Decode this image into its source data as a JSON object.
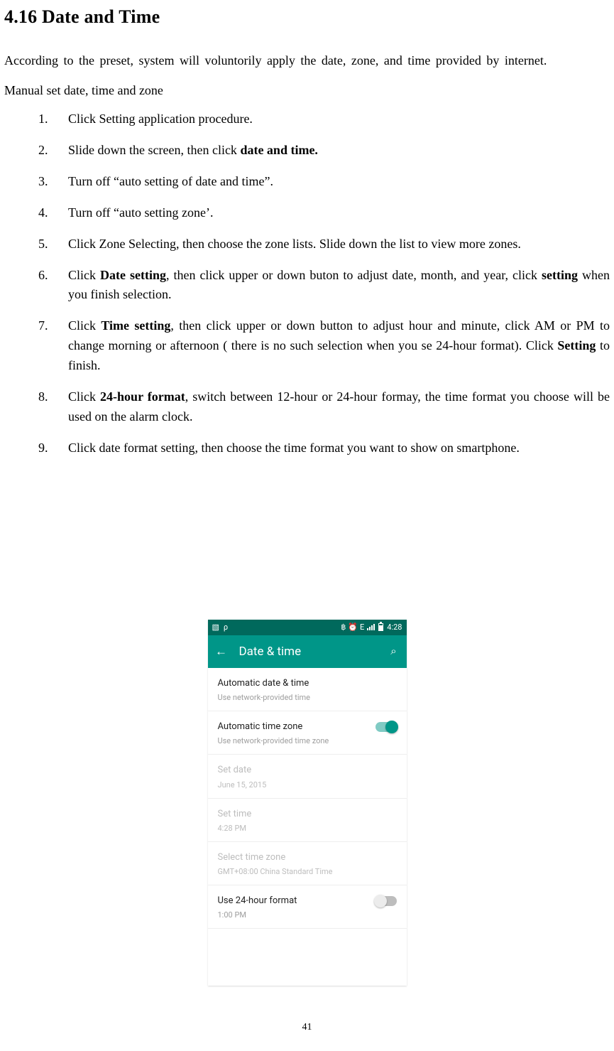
{
  "section_title": "4.16 Date and Time",
  "intro": "According to the preset, system will voluntorily apply the date, zone, and time provided by internet.",
  "subtitle": "Manual set date, time and zone",
  "list": [
    {
      "num": "1.",
      "pre": "Click Setting application procedure."
    },
    {
      "num": "2.",
      "pre": "Slide down the screen, then click ",
      "bold1": "date and time."
    },
    {
      "num": "3.",
      "pre": "Turn off “auto setting of date and time”."
    },
    {
      "num": "4.",
      "pre": "Turn off “auto setting zone’."
    },
    {
      "num": "5.",
      "pre": "Click Zone Selecting, then choose the zone lists. Slide down the list to view more zones."
    },
    {
      "num": "6.",
      "pre": "Click ",
      "bold1": "Date setting",
      "mid": ", then click upper or down buton to adjust date, month, and year, click ",
      "bold2": "setting",
      "post": " when you finish selection."
    },
    {
      "num": "7.",
      "pre": "Click ",
      "bold1": "Time setting",
      "mid": ", then click upper or down button to adjust hour and minute, click AM or PM to change morning or afternoon ( there is no such selection when you se 24-hour format). Click ",
      "bold2": "Setting",
      "post": " to finish."
    },
    {
      "num": "8.",
      "pre": "Click ",
      "bold1": "24-hour format",
      "mid": ", switch between 12-hour or 24-hour formay, the time format you choose will be used on the alarm clock."
    },
    {
      "num": "9.",
      "pre": "Click date format setting, then choose the time format you want to show on smartphone."
    }
  ],
  "phone": {
    "status": {
      "bt": "฿",
      "letter_e": "E",
      "clock": "4:28"
    },
    "appbar": {
      "back": "←",
      "title": "Date & time",
      "search": "⌕"
    },
    "rows": [
      {
        "primary": "Automatic date & time",
        "secondary": "Use network-provided time",
        "toggle": null,
        "enabled": true
      },
      {
        "primary": "Automatic time zone",
        "secondary": "Use network-provided time zone",
        "toggle": "on",
        "enabled": true
      },
      {
        "primary": "Set date",
        "secondary": "June 15, 2015",
        "toggle": null,
        "enabled": false
      },
      {
        "primary": "Set time",
        "secondary": "4:28 PM",
        "toggle": null,
        "enabled": false
      },
      {
        "primary": "Select time zone",
        "secondary": "GMT+08:00 China Standard Time",
        "toggle": null,
        "enabled": false
      },
      {
        "primary": "Use 24-hour format",
        "secondary": "1:00 PM",
        "toggle": "off",
        "enabled": true
      }
    ]
  },
  "page_number": "41"
}
